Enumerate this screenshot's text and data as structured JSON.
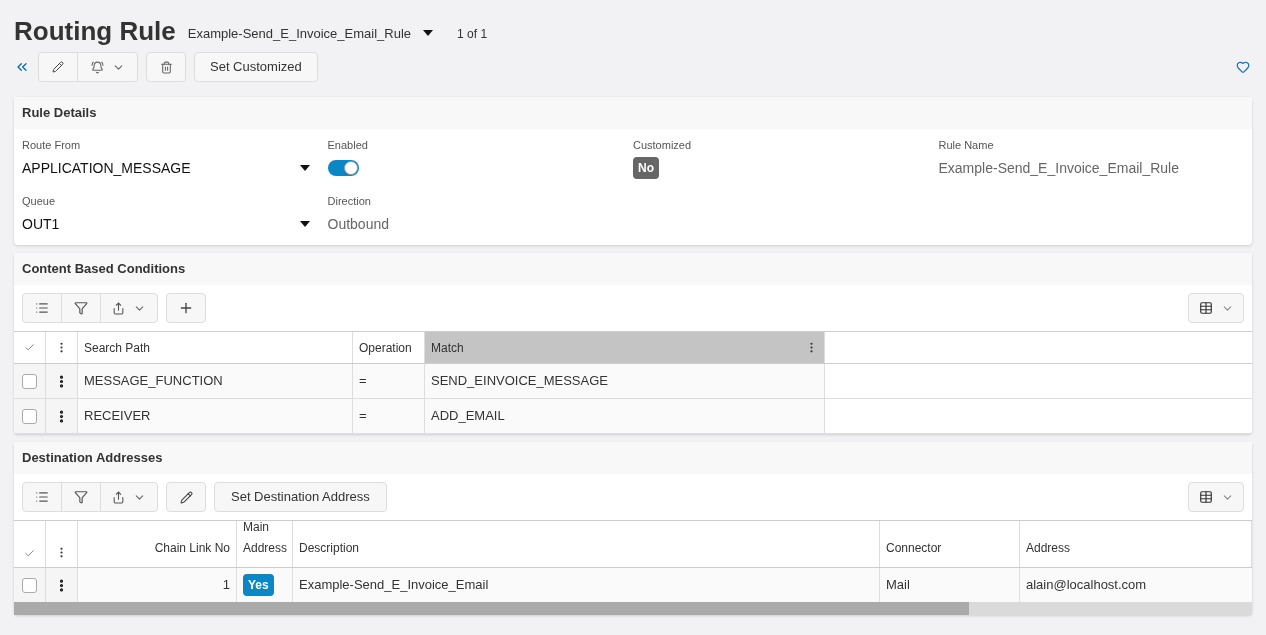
{
  "header": {
    "title": "Routing Rule",
    "record_name": "Example-Send_E_Invoice_Email_Rule",
    "record_count": "1 of 1"
  },
  "toolbar": {
    "set_customized": "Set Customized"
  },
  "rule_details": {
    "title": "Rule Details",
    "fields": [
      {
        "kind": "select",
        "label": "Route From",
        "value": "APPLICATION_MESSAGE"
      },
      {
        "kind": "toggle",
        "label": "Enabled",
        "on": true
      },
      {
        "kind": "badge",
        "label": "Customized",
        "value": "No",
        "on": false
      },
      {
        "kind": "text",
        "label": "Rule Name",
        "value": "Example-Send_E_Invoice_Email_Rule"
      },
      {
        "kind": "select",
        "label": "Queue",
        "value": "OUT1"
      },
      {
        "kind": "text",
        "label": "Direction",
        "value": "Outbound"
      }
    ]
  },
  "conditions": {
    "title": "Content Based Conditions",
    "columns": [
      {
        "label": "Search Path",
        "selected": false
      },
      {
        "label": "Operation",
        "selected": false
      },
      {
        "label": "Match",
        "selected": true
      }
    ],
    "rows": [
      {
        "checked": false,
        "cells": [
          "MESSAGE_FUNCTION",
          "=",
          "SEND_EINVOICE_MESSAGE"
        ]
      },
      {
        "checked": false,
        "cells": [
          "RECEIVER",
          "=",
          "ADD_EMAIL"
        ]
      }
    ]
  },
  "destinations": {
    "title": "Destination Addresses",
    "set_button": "Set Destination Address",
    "columns": [
      {
        "line2": "Chain Link No"
      },
      {
        "line1": "Main",
        "line2": "Address"
      },
      {
        "line2": "Description"
      },
      {
        "line2": "Connector"
      },
      {
        "line2": "Address"
      }
    ],
    "rows": [
      {
        "checked": false,
        "chain_link_no": "1",
        "main_address": {
          "value": "Yes",
          "on": true
        },
        "description": "Example-Send_E_Invoice_Email",
        "connector": "Mail",
        "address": "alain@localhost.com"
      }
    ]
  }
}
